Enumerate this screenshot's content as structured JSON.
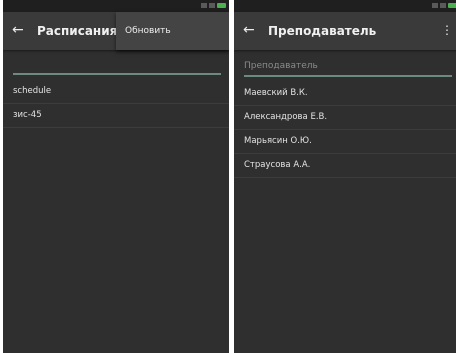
{
  "left_screen": {
    "title": "Расписания",
    "menu_item": "Обновить",
    "items": [
      "schedule",
      "зис-45"
    ]
  },
  "right_screen": {
    "title": "Преподаватель",
    "search_placeholder": "Преподаватель",
    "items": [
      "Маевский В.К.",
      "Александрова Е.В.",
      "Марьясин О.Ю.",
      "Страусова А.А."
    ]
  },
  "colors": {
    "background": "#2f2f2f",
    "appbar": "#3a3a3a",
    "accent": "#6b8a80",
    "battery": "#4caf50"
  },
  "icons": [
    "back-arrow-icon",
    "overflow-menu-icon",
    "signal-icon",
    "wifi-icon",
    "battery-icon"
  ]
}
